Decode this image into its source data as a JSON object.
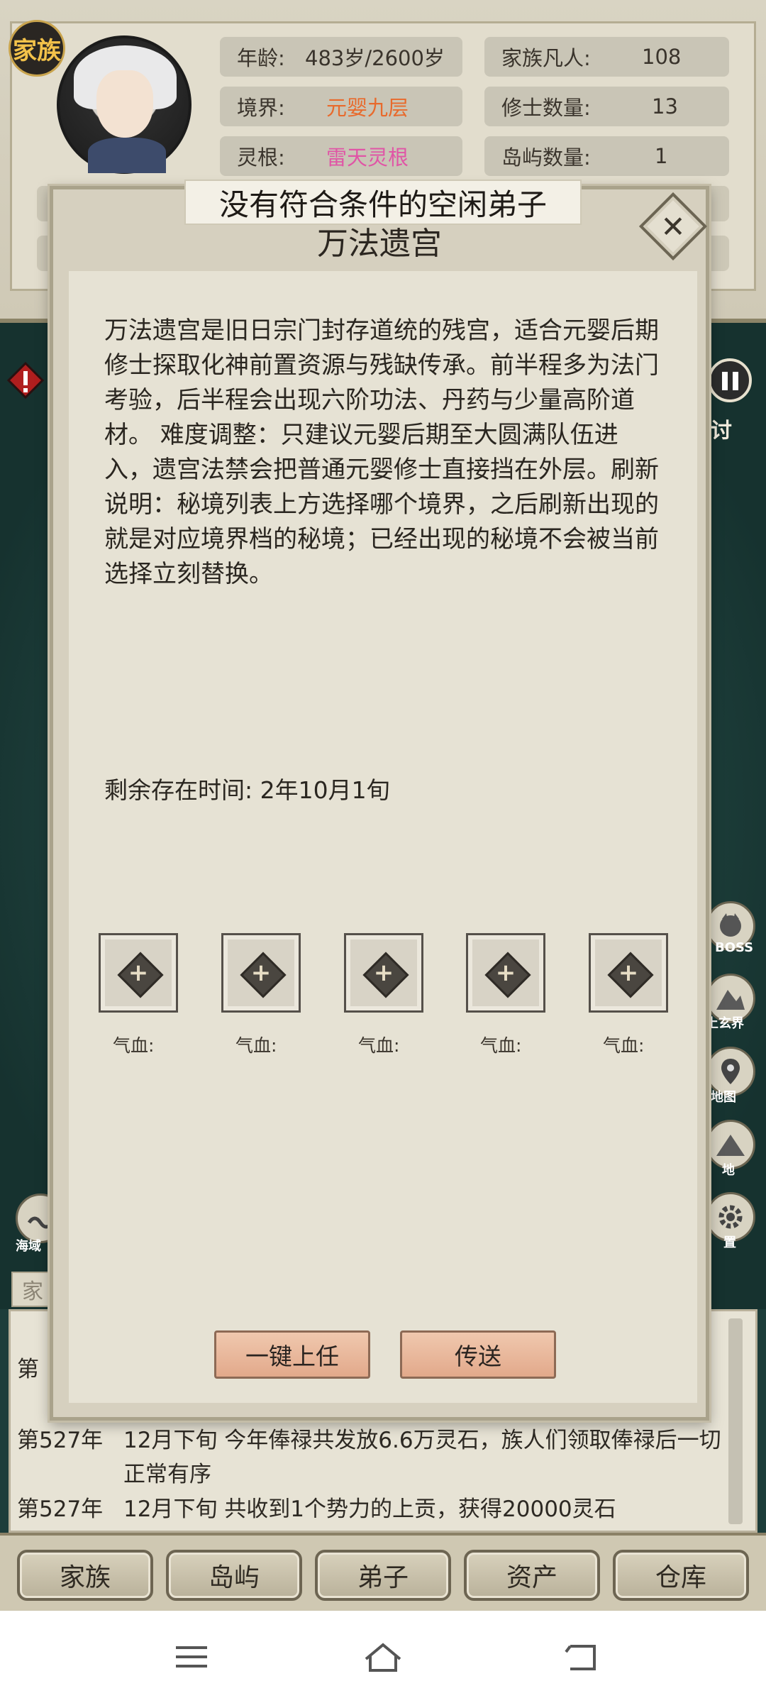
{
  "header": {
    "clan_badge": "家族",
    "stats": {
      "age_label": "年龄:",
      "age_value": "483岁/2600岁",
      "realm_label": "境界:",
      "realm_value": "元婴九层",
      "root_label": "灵根:",
      "root_value": "雷天灵根",
      "mortals_label": "家族凡人:",
      "mortals_value": "108",
      "cultivators_label": "修士数量:",
      "cultivators_value": "13",
      "islands_label": "岛屿数量:",
      "islands_value": "1"
    }
  },
  "toast": "没有符合条件的空闲弟子",
  "modal": {
    "title": "万法遗宫",
    "close_icon": "✕",
    "description": "万法遗宫是旧日宗门封存道统的残宫，适合元婴后期修士探取化神前置资源与残缺传承。前半程多为法门考验，后半程会出现六阶功法、丹药与少量高阶道材。 难度调整：只建议元婴后期至大圆满队伍进入，遗宫法禁会把普通元婴修士直接挡在外层。刷新说明：秘境列表上方选择哪个境界，之后刷新出现的就是对应境界档的秘境；已经出现的秘境不会被当前选择立刻替换。",
    "remaining_time": "剩余存在时间:  2年10月1旬",
    "slots": [
      {
        "hp_label": "气血:"
      },
      {
        "hp_label": "气血:"
      },
      {
        "hp_label": "气血:"
      },
      {
        "hp_label": "气血:"
      },
      {
        "hp_label": "气血:"
      }
    ],
    "assign_all_button": "一键上任",
    "teleport_button": "传送"
  },
  "background": {
    "side_right_labels": [
      "讨",
      "BOSS",
      "上玄界",
      "地图",
      "地",
      "置"
    ],
    "side_left_labels": [
      "海域",
      "家"
    ],
    "log_partial": "第"
  },
  "log": [
    {
      "year": "第527年",
      "text": "12月下旬 今年俸禄共发放6.6万灵石，族人们领取俸禄后一切正常有序"
    },
    {
      "year": "第527年",
      "text": "12月下旬 共收到1个势力的上贡，获得20000灵石"
    }
  ],
  "bottom_nav": [
    "家族",
    "岛屿",
    "弟子",
    "资产",
    "仓库"
  ],
  "colors": {
    "realm_value": "#e86a2c",
    "root_value": "#e055a6",
    "action_button": "#e8b498"
  }
}
